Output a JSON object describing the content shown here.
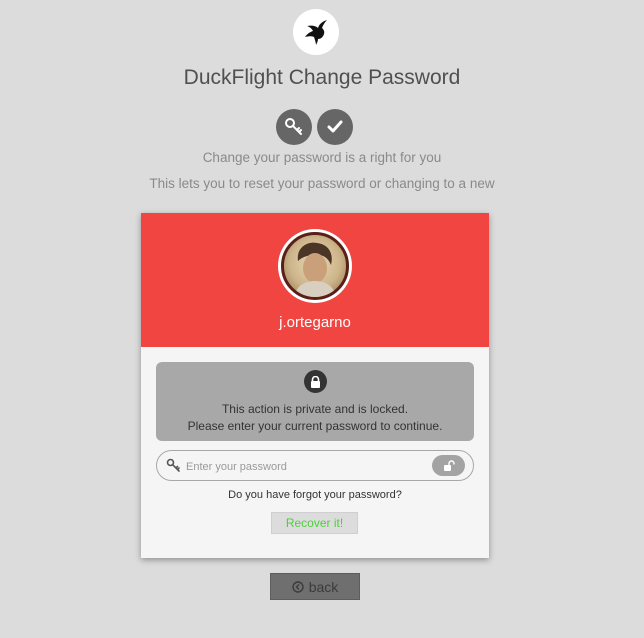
{
  "brand": {
    "icon": "duck-icon"
  },
  "header": {
    "title": "DuckFlight Change Password",
    "steps": [
      {
        "icon": "key-icon"
      },
      {
        "icon": "check-icon"
      }
    ],
    "subtitle_1": "Change your password is a right for you",
    "subtitle_2": "This lets you to reset your password or changing to a new"
  },
  "card": {
    "header_color": "#f04540",
    "username": "j.ortegarno",
    "locked": {
      "icon": "lock-icon",
      "line_1": "This action is private and is locked.",
      "line_2": "Please enter your current password to continue."
    },
    "password": {
      "placeholder": "Enter your password",
      "value": "",
      "key_icon": "key-icon",
      "unlock_icon": "unlock-icon"
    },
    "forgot_text": "Do you have forgot your password?",
    "recover_label": "Recover it!"
  },
  "footer": {
    "back_label": "back",
    "back_icon": "circle-arrow-left-icon"
  }
}
